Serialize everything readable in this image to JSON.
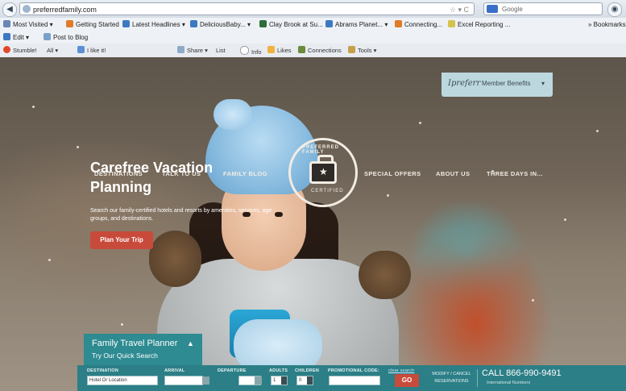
{
  "browser": {
    "url": "preferredfamily.com",
    "search_placeholder": "Google",
    "bookmarks": [
      {
        "label": "Most Visited",
        "color": "#6a86b5"
      },
      {
        "label": "Getting Started",
        "color": "#e07b28"
      },
      {
        "label": "Latest Headlines",
        "color": "#3d78c2"
      },
      {
        "label": "DeliciousBaby...",
        "color": "#3d78c2"
      },
      {
        "label": "Clay Brook at Su...",
        "color": "#2d6d3a"
      },
      {
        "label": "Abrams Planet...",
        "color": "#3d78c2"
      },
      {
        "label": "Connecting...",
        "color": "#e07b28"
      },
      {
        "label": "Excel Reporting ...",
        "color": "#d6c24a"
      }
    ],
    "bookmarks_overflow": "Bookmarks",
    "toolbar2": {
      "edit": "Edit",
      "post": "Post to Blog"
    },
    "toolbar3": {
      "stumble": "Stumble!",
      "all": "All",
      "like": "I like it!",
      "share": "Share",
      "list": "List",
      "info": "Info",
      "likes": "Likes",
      "connections": "Connections",
      "tools": "Tools"
    }
  },
  "site": {
    "member_sig": "Ipreferr",
    "member_benefits": "Member Benefits",
    "logo_top": "PREFERRED FAMILY",
    "logo_bottom": "CERTIFIED",
    "nav": [
      "DESTINATIONS",
      "TALK TO US",
      "FAMILY BLOG",
      "SPECIAL OFFERS",
      "ABOUT US",
      "THREE DAYS IN..."
    ],
    "headline_1": "Carefree Vacation",
    "headline_2": "Planning",
    "subtext": "Search our family-certified hotels and resorts by amenities, services, age groups, and destinations.",
    "cta": "Plan Your Trip"
  },
  "planner": {
    "title": "Family Travel Planner",
    "subtitle": "Try Our Quick Search",
    "labels": {
      "destination": "DESTINATION",
      "arrival": "ARRIVAL",
      "departure": "DEPARTURE",
      "adults": "ADULTS",
      "children": "CHILDREN",
      "promo": "PROMOTIONAL CODE:",
      "clear": "clear search"
    },
    "destination_value": "Hotel Or Location",
    "adults_value": "1",
    "children_value": "0",
    "go": "GO",
    "modify": "MODIFY / CANCEL RESERVATIONS",
    "call": "CALL 866-990-9491",
    "intl": "International Numbers"
  }
}
